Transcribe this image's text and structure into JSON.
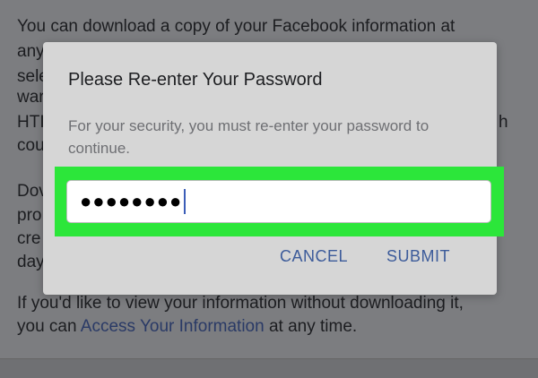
{
  "background": {
    "lines": [
      "You can download a copy of your Facebook information at",
      "any",
      "sele",
      "war",
      "HTI",
      "cou",
      "Dov",
      "pro",
      "cre",
      "day"
    ],
    "right_fragment": "h",
    "footer_prefix_1": "If you'd like to view your information without downloading it,",
    "footer_prefix_2": "you can ",
    "footer_link": "Access Your Information",
    "footer_suffix": " at any time."
  },
  "dialog": {
    "title": "Please Re-enter Your Password",
    "message": "For your security, you must re-enter your password to continue.",
    "password_value": "●●●●●●●●",
    "cancel_label": "CANCEL",
    "submit_label": "SUBMIT"
  },
  "colors": {
    "highlight": "#2ce63a",
    "button_text": "#3c5b9a",
    "caret": "#3b5db8"
  }
}
